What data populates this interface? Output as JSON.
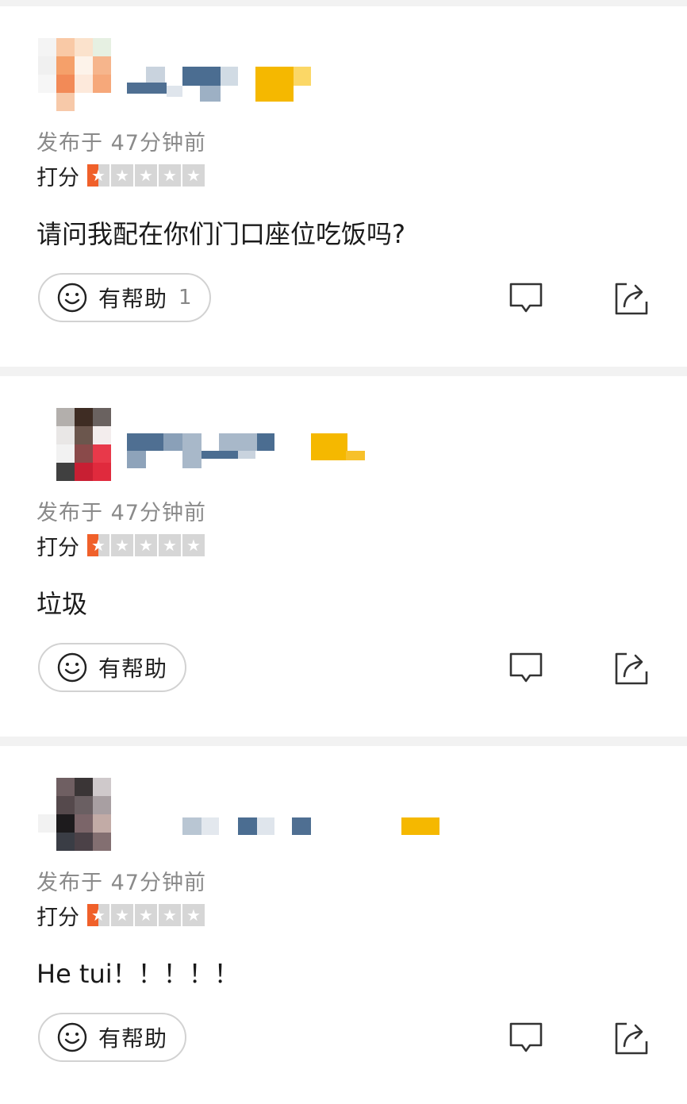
{
  "reviews": [
    {
      "time": "发布于 47分钟前",
      "rating_label": "打分",
      "rating": 0.5,
      "rating_max": 5,
      "content": "请问我配在你们门口座位吃饭吗?",
      "helpful_label": "有帮助",
      "helpful_count": "1"
    },
    {
      "time": "发布于 47分钟前",
      "rating_label": "打分",
      "rating": 0.5,
      "rating_max": 5,
      "content": "垃圾",
      "helpful_label": "有帮助",
      "helpful_count": ""
    },
    {
      "time": "发布于 47分钟前",
      "rating_label": "打分",
      "rating": 0.5,
      "rating_max": 5,
      "content": "He tui！！！！！",
      "helpful_label": "有帮助",
      "helpful_count": ""
    }
  ],
  "icons": {
    "helpful": "smiley-icon",
    "comment": "comment-icon",
    "share": "share-icon"
  },
  "colors": {
    "star_active": "#f0602a",
    "star_inactive": "#d6d6d6",
    "badge": "#f5b800"
  }
}
